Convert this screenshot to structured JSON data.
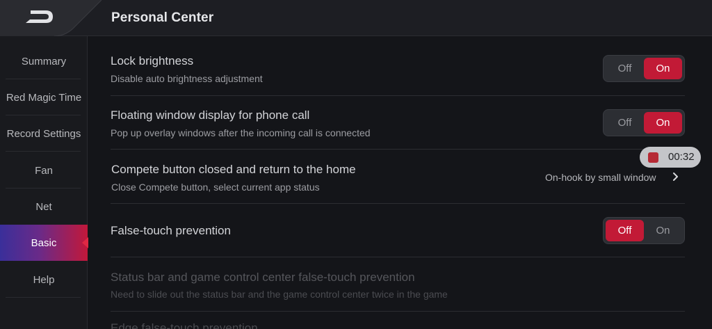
{
  "header": {
    "title": "Personal Center",
    "back_icon": "back-arrow-icon"
  },
  "sidebar": {
    "items": [
      {
        "label": "Summary"
      },
      {
        "label": "Red Magic Time"
      },
      {
        "label": "Record Settings"
      },
      {
        "label": "Fan"
      },
      {
        "label": "Net"
      },
      {
        "label": "Basic",
        "active": true
      },
      {
        "label": "Help"
      }
    ]
  },
  "settings": [
    {
      "title": "Lock brightness",
      "subtitle": "Disable auto brightness adjustment",
      "off_label": "Off",
      "on_label": "On",
      "value": "On"
    },
    {
      "title": "Floating window display for phone call",
      "subtitle": "Pop up overlay windows after the incoming call is connected",
      "off_label": "Off",
      "on_label": "On",
      "value": "On"
    },
    {
      "title": "Compete button closed and return to the home",
      "subtitle": "Close Compete button, select current app status",
      "value_text": "On-hook by small window"
    },
    {
      "title": "False-touch prevention",
      "off_label": "Off",
      "on_label": "On",
      "value": "Off"
    },
    {
      "title": "Status bar and game control center false-touch prevention",
      "subtitle": "Need to slide out the status bar and the game control center twice in the game",
      "disabled": true
    },
    {
      "title": "Edge false-touch prevention",
      "disabled": true
    }
  ],
  "recording_timer": {
    "time": "00:32",
    "icon": "record-stop-icon"
  },
  "colors": {
    "accent": "#c21a36",
    "background": "#141519",
    "sidebar_active_start": "#3a2f9a",
    "sidebar_active_end": "#c2183a"
  }
}
